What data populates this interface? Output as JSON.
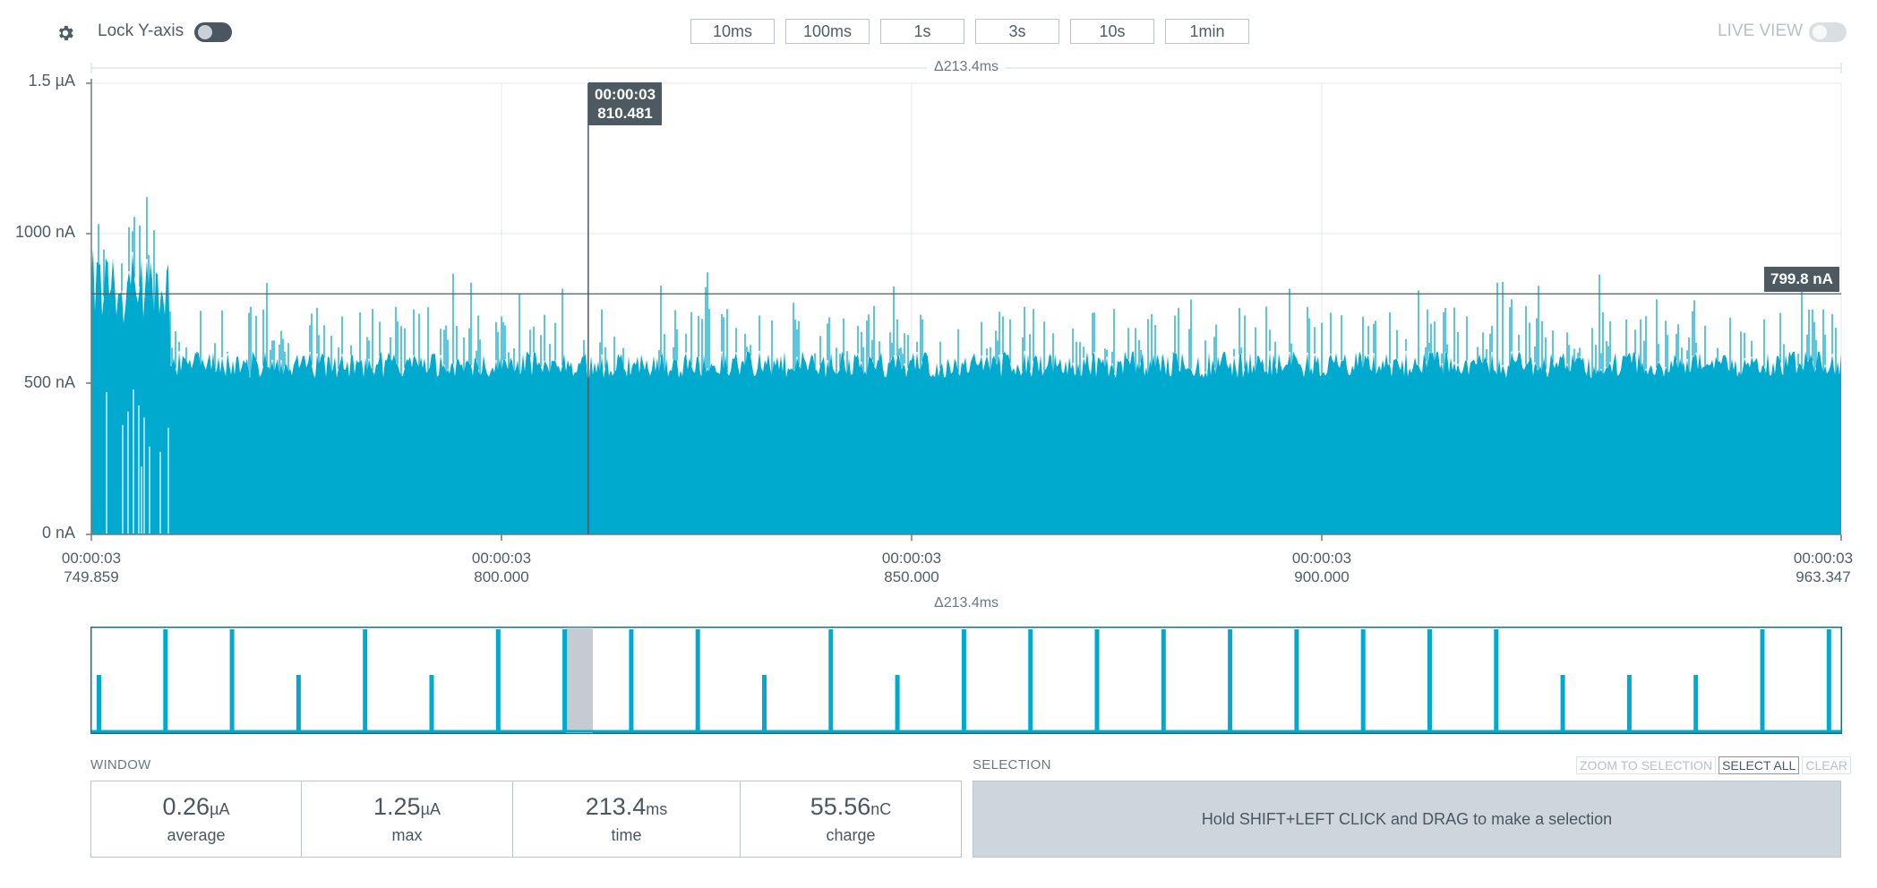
{
  "toolbar": {
    "lock_y_label": "Lock Y-axis",
    "live_view_label": "LIVE VIEW",
    "window_buttons": [
      "10ms",
      "100ms",
      "1s",
      "3s",
      "10s",
      "1min"
    ]
  },
  "colors": {
    "signal": "#00a9ce",
    "cursor": "#4d5a62",
    "selection": "#c5ccd1"
  },
  "chart_data": {
    "type": "area",
    "title": "",
    "y_ticks": [
      "1.5 µA",
      "1000 nA",
      "500 nA",
      "0 nA"
    ],
    "x_ticks": [
      {
        "top": "00:00:03",
        "bottom": "749.859"
      },
      {
        "top": "00:00:03",
        "bottom": "800.000"
      },
      {
        "top": "00:00:03",
        "bottom": "850.000"
      },
      {
        "top": "00:00:03",
        "bottom": "900.000"
      },
      {
        "top": "00:00:03",
        "bottom": "963.347"
      }
    ],
    "x_range_ms": [
      749.859,
      963.347
    ],
    "y_range_nA": [
      0,
      1500
    ],
    "delta_label": "Δ213.4ms",
    "cursor": {
      "time_top": "00:00:03",
      "time_bottom": "810.481",
      "x_ms": 810.481
    },
    "horizontal_line": {
      "label": "799.8 nA",
      "value_nA": 799.8
    },
    "grid": true
  },
  "minimap": {
    "delta_label": "Δ213.4ms",
    "pulse_count": 27
  },
  "window": {
    "label": "WINDOW",
    "stats": [
      {
        "value": "0.26",
        "unit": "µA",
        "name": "average"
      },
      {
        "value": "1.25",
        "unit": "µA",
        "name": "max"
      },
      {
        "value": "213.4",
        "unit": "ms",
        "name": "time"
      },
      {
        "value": "55.56",
        "unit": "nC",
        "name": "charge"
      }
    ]
  },
  "selection": {
    "label": "SELECTION",
    "hint": "Hold SHIFT+LEFT CLICK and DRAG to make a selection",
    "buttons": [
      "ZOOM TO SELECTION",
      "SELECT ALL",
      "CLEAR"
    ]
  }
}
